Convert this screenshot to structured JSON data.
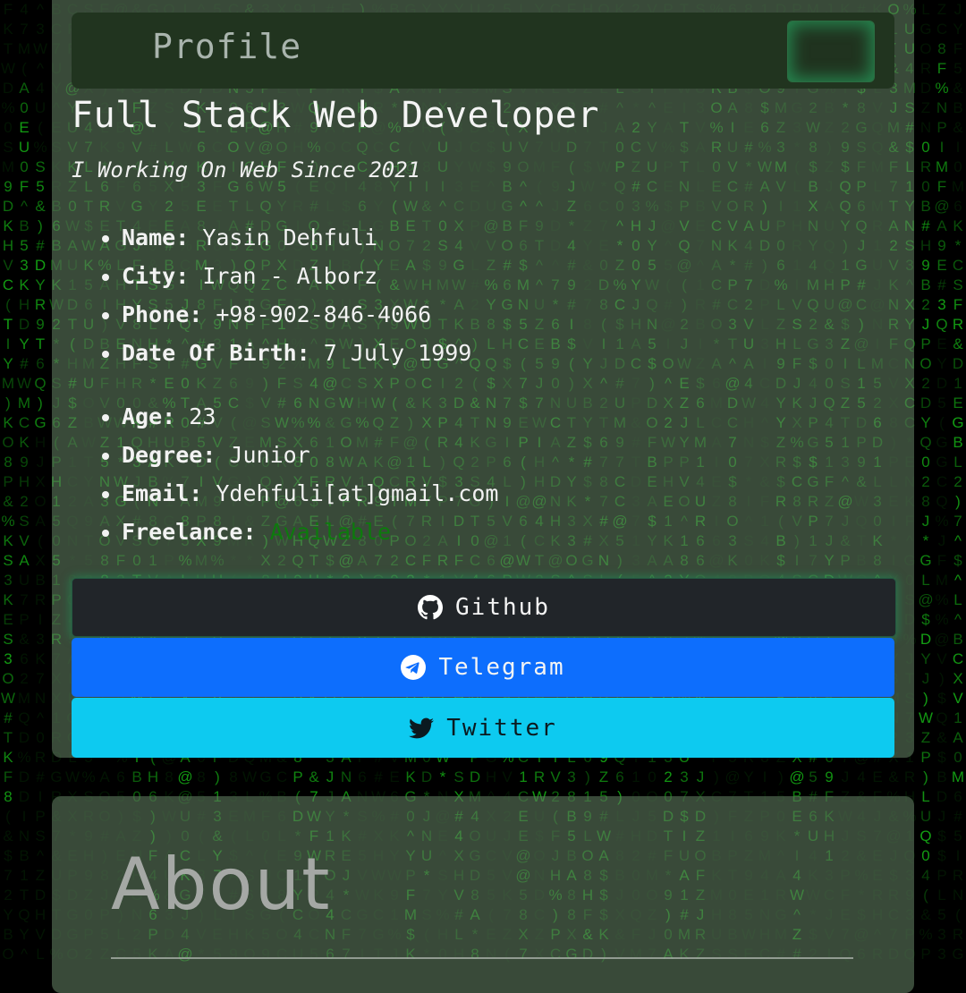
{
  "header": {
    "title": "Profile",
    "menu_toggle_icon": "menu-toggle-icon"
  },
  "profile": {
    "headline": "Full Stack Web Developer",
    "tagline": "I Working On Web Since 2021",
    "info_primary": [
      {
        "label": "Name:",
        "value": "Yasin Dehfuli"
      },
      {
        "label": "City:",
        "value": "Iran - Alborz"
      },
      {
        "label": "Phone:",
        "value": "+98-902-846-4066"
      },
      {
        "label": "Date Of Birth:",
        "value": "7 July 1999"
      }
    ],
    "info_secondary": [
      {
        "label": "Age:",
        "value": "23"
      },
      {
        "label": "Degree:",
        "value": "Junior"
      },
      {
        "label": "Email:",
        "value": "Ydehfuli[at]gmail.com"
      },
      {
        "label": "Freelance:",
        "value": "Available"
      }
    ]
  },
  "social": {
    "github": {
      "label": "Github",
      "icon": "github-icon",
      "color": "#212529"
    },
    "telegram": {
      "label": "Telegram",
      "icon": "telegram-icon",
      "color": "#0d6efd"
    },
    "twitter": {
      "label": "Twitter",
      "icon": "twitter-icon",
      "color": "#0dcaf0"
    }
  },
  "about": {
    "title": "About"
  },
  "theme": {
    "matrix_green": "#14a014",
    "available_color": "#0d7a0d"
  }
}
